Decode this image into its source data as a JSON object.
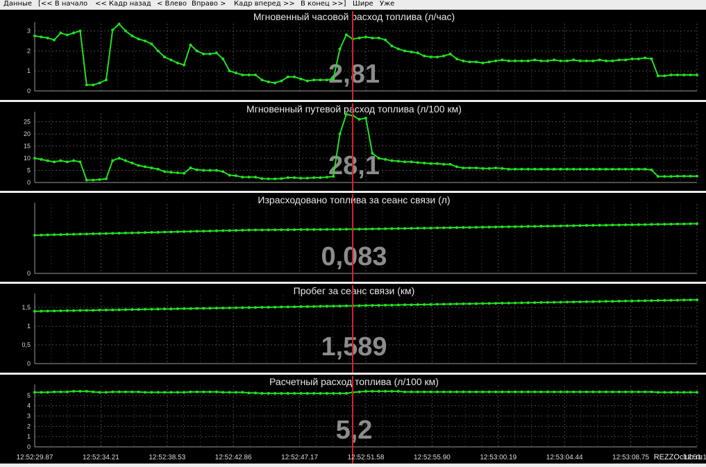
{
  "toolbar": {
    "items": [
      "Данные",
      "[<< В начало",
      "<< Кадр назад",
      "< Влево",
      "Вправо >",
      "Кадр вперед >>",
      "В конец >>]",
      "Шире",
      "Уже"
    ]
  },
  "cursor_time_index": 10,
  "x_ticks": [
    "12:52:29.87",
    "12:52:34.21",
    "12:52:38.53",
    "12:52:42.86",
    "12:52:47.17",
    "12:52:51.58",
    "12:52:55.90",
    "12:53:00.19",
    "12:53:04.44",
    "12:53:08.75",
    "12:53:13"
  ],
  "watermark": "REZZOclub.ru",
  "colors": {
    "series": "#22e022",
    "cursor": "#e02020",
    "panel_background": "#000000",
    "value_text": "#8c8c8c"
  },
  "chart_data": [
    {
      "type": "line",
      "title": "Мгновенный часовой расход топлива  (л/час)",
      "current_value": "2,81",
      "ylim": [
        0,
        3.3
      ],
      "y_ticks": [
        "0",
        "1",
        "2",
        "3"
      ],
      "y_tick_values": [
        0,
        1,
        2,
        3
      ],
      "series": [
        {
          "values": [
            2.75,
            2.7,
            2.65,
            2.55,
            2.9,
            2.8,
            2.9,
            3.0,
            0.3,
            0.3,
            0.4,
            0.55,
            3.05,
            3.35,
            3.0,
            2.75,
            2.6,
            2.5,
            2.35,
            2.0,
            1.7,
            1.55,
            1.4,
            1.3,
            2.3,
            2.0,
            1.85,
            1.85,
            1.9,
            1.6,
            1.0,
            0.9,
            0.8,
            0.8,
            0.8,
            0.55,
            0.45,
            0.4,
            0.5,
            0.7,
            0.7,
            0.6,
            0.5,
            0.55,
            0.55,
            0.55,
            0.6,
            2.1,
            2.81,
            2.6,
            2.65,
            2.7,
            2.65,
            2.65,
            2.55,
            2.25,
            2.1,
            2.0,
            1.95,
            1.9,
            1.75,
            1.7,
            1.7,
            1.75,
            1.85,
            1.6,
            1.5,
            1.45,
            1.45,
            1.4,
            1.45,
            1.5,
            1.55,
            1.5,
            1.5,
            1.5,
            1.5,
            1.55,
            1.5,
            1.5,
            1.55,
            1.5,
            1.5,
            1.55,
            1.5,
            1.5,
            1.5,
            1.55,
            1.5,
            1.5,
            1.55,
            1.55,
            1.6,
            1.6,
            1.65,
            1.6,
            0.75,
            0.75,
            0.8,
            0.8,
            0.8,
            0.8,
            0.8
          ]
        }
      ]
    },
    {
      "type": "line",
      "title": "Мгновенный путевой расход топлива  (л/100 км)",
      "current_value": "28,1",
      "ylim": [
        0,
        28
      ],
      "y_ticks": [
        "0",
        "5",
        "10",
        "15",
        "20",
        "25"
      ],
      "y_tick_values": [
        0,
        5,
        10,
        15,
        20,
        25
      ],
      "series": [
        {
          "values": [
            10,
            9.5,
            9,
            8.5,
            9,
            8.5,
            9,
            8.5,
            1,
            1,
            1.2,
            1.5,
            9,
            10,
            9,
            8,
            7,
            6.5,
            6,
            5.5,
            4.5,
            4.2,
            4,
            3.8,
            6,
            5.2,
            5,
            5,
            5,
            4.5,
            3,
            2.8,
            2.2,
            2.2,
            2.2,
            1.6,
            1.5,
            1.5,
            1.6,
            2,
            2,
            1.8,
            1.8,
            2,
            2,
            2.2,
            2.5,
            20,
            28.1,
            27.5,
            26,
            26.5,
            12,
            10,
            9.5,
            9,
            8.8,
            8.5,
            8.5,
            8.2,
            8,
            7.8,
            7.8,
            7.5,
            7.5,
            6.5,
            6,
            6,
            6,
            5.8,
            5.8,
            6,
            5.8,
            5.5,
            5.5,
            5.5,
            5.5,
            5.5,
            5.5,
            5.5,
            5.5,
            5.5,
            5.5,
            5.5,
            5.5,
            5.5,
            5.5,
            5.5,
            5.5,
            5.5,
            5.5,
            5.5,
            5.5,
            5.5,
            5.5,
            5.2,
            2.5,
            2.5,
            2.5,
            2.6,
            2.6,
            2.6,
            2.6
          ]
        }
      ]
    },
    {
      "type": "line",
      "title": "Израсходовано топлива за сеанс связи  (л)",
      "current_value": "0,083",
      "ylim": [
        0,
        0.13
      ],
      "y_ticks": [
        "0"
      ],
      "y_tick_values": [
        0
      ],
      "series": [
        {
          "values": [
            0.073,
            0.0733,
            0.0736,
            0.0739,
            0.0742,
            0.0745,
            0.0748,
            0.0751,
            0.0754,
            0.0757,
            0.076,
            0.0763,
            0.0766,
            0.0769,
            0.0772,
            0.0775,
            0.0778,
            0.0781,
            0.0784,
            0.0787,
            0.079,
            0.0793,
            0.0796,
            0.0799,
            0.0802,
            0.0805,
            0.0808,
            0.0811,
            0.0814,
            0.0817,
            0.082,
            0.0823,
            0.0826,
            0.0829,
            0.083,
            0.0831,
            0.0832,
            0.0833,
            0.0834,
            0.0835,
            0.0836,
            0.0837,
            0.0838,
            0.0839,
            0.084,
            0.0841,
            0.0842,
            0.0843,
            0.0844,
            0.0845,
            0.0846,
            0.0848,
            0.085,
            0.0852,
            0.0854,
            0.0856,
            0.0858,
            0.086,
            0.0862,
            0.0864,
            0.0866,
            0.0868,
            0.087,
            0.0872,
            0.0874,
            0.0876,
            0.0878,
            0.088,
            0.0882,
            0.0884,
            0.0886,
            0.0888,
            0.089,
            0.0892,
            0.0894,
            0.0896,
            0.0898,
            0.09,
            0.0902,
            0.0904,
            0.0906,
            0.0908,
            0.091,
            0.0912,
            0.0914,
            0.0916,
            0.0918,
            0.092,
            0.0922,
            0.0924,
            0.0926,
            0.0928,
            0.093,
            0.0932,
            0.0934,
            0.0936,
            0.0938,
            0.094,
            0.0942,
            0.0944,
            0.0946,
            0.0948,
            0.095
          ]
        }
      ]
    },
    {
      "type": "line",
      "title": "Пробег за сеанс связи  (км)",
      "current_value": "1,589",
      "ylim": [
        0,
        1.8
      ],
      "y_ticks": [
        "0",
        "0,5",
        "1",
        "1,5"
      ],
      "y_tick_values": [
        0,
        0.5,
        1,
        1.5
      ],
      "series": [
        {
          "values": [
            1.4,
            1.403,
            1.406,
            1.409,
            1.412,
            1.415,
            1.418,
            1.421,
            1.424,
            1.427,
            1.43,
            1.433,
            1.436,
            1.439,
            1.442,
            1.445,
            1.448,
            1.451,
            1.454,
            1.457,
            1.46,
            1.463,
            1.466,
            1.469,
            1.472,
            1.475,
            1.478,
            1.481,
            1.484,
            1.487,
            1.49,
            1.493,
            1.496,
            1.499,
            1.502,
            1.505,
            1.508,
            1.511,
            1.514,
            1.517,
            1.52,
            1.523,
            1.526,
            1.529,
            1.532,
            1.535,
            1.538,
            1.541,
            1.544,
            1.547,
            1.55,
            1.553,
            1.556,
            1.559,
            1.562,
            1.565,
            1.568,
            1.571,
            1.574,
            1.577,
            1.58,
            1.583,
            1.586,
            1.589,
            1.592,
            1.595,
            1.598,
            1.601,
            1.604,
            1.607,
            1.61,
            1.613,
            1.616,
            1.619,
            1.622,
            1.625,
            1.628,
            1.631,
            1.634,
            1.637,
            1.64,
            1.643,
            1.646,
            1.649,
            1.652,
            1.655,
            1.658,
            1.661,
            1.664,
            1.667,
            1.67,
            1.673,
            1.676,
            1.679,
            1.682,
            1.685,
            1.688,
            1.691,
            1.694,
            1.697,
            1.7,
            1.703,
            1.706
          ]
        }
      ]
    },
    {
      "type": "line",
      "title": "Расчетный расход топлива  (л/100 км)",
      "current_value": "5,2",
      "ylim": [
        0,
        5.8
      ],
      "y_ticks": [
        "0",
        "1",
        "2",
        "3",
        "4",
        "5"
      ],
      "y_tick_values": [
        0,
        1,
        2,
        3,
        4,
        5
      ],
      "series": [
        {
          "values": [
            5.3,
            5.3,
            5.3,
            5.35,
            5.35,
            5.35,
            5.4,
            5.4,
            5.4,
            5.35,
            5.3,
            5.3,
            5.35,
            5.35,
            5.35,
            5.35,
            5.35,
            5.3,
            5.3,
            5.3,
            5.3,
            5.3,
            5.3,
            5.3,
            5.35,
            5.35,
            5.35,
            5.35,
            5.35,
            5.3,
            5.3,
            5.3,
            5.3,
            5.25,
            5.25,
            5.2,
            5.2,
            5.2,
            5.2,
            5.2,
            5.2,
            5.2,
            5.2,
            5.2,
            5.2,
            5.2,
            5.2,
            5.2,
            5.2,
            5.3,
            5.35,
            5.4,
            5.4,
            5.4,
            5.4,
            5.4,
            5.4,
            5.35,
            5.35,
            5.35,
            5.35,
            5.35,
            5.35,
            5.35,
            5.35,
            5.35,
            5.35,
            5.35,
            5.35,
            5.35,
            5.35,
            5.35,
            5.35,
            5.35,
            5.35,
            5.35,
            5.35,
            5.35,
            5.35,
            5.35,
            5.35,
            5.35,
            5.35,
            5.35,
            5.35,
            5.35,
            5.35,
            5.35,
            5.35,
            5.35,
            5.35,
            5.35,
            5.35,
            5.35,
            5.35,
            5.35,
            5.3,
            5.3,
            5.3,
            5.3,
            5.3,
            5.3,
            5.3
          ]
        }
      ]
    }
  ]
}
